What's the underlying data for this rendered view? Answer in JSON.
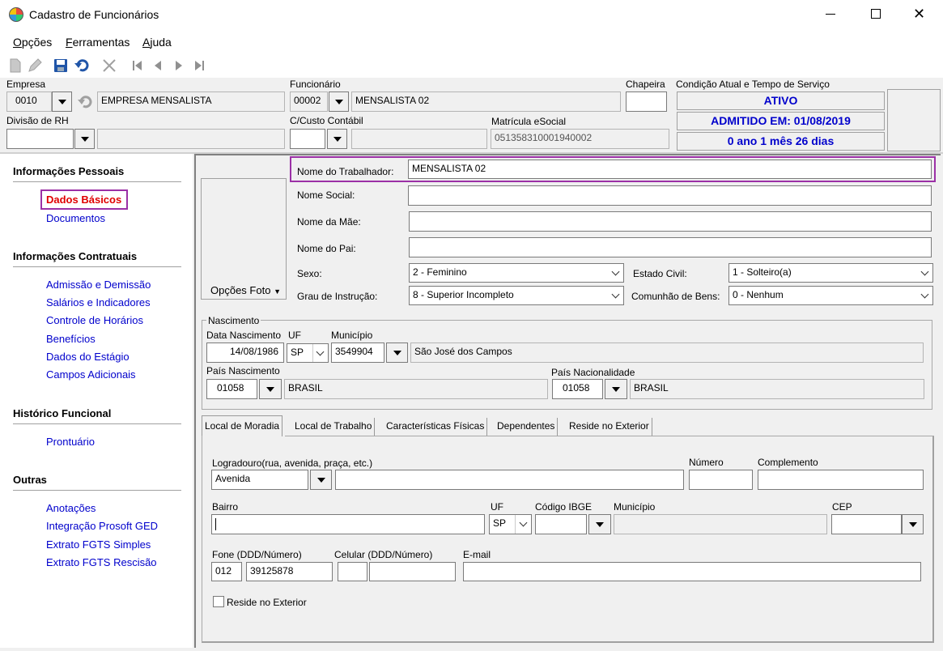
{
  "window": {
    "title": "Cadastro de Funcionários"
  },
  "menu": [
    {
      "pre": "",
      "key": "O",
      "post": "pções"
    },
    {
      "pre": "",
      "key": "F",
      "post": "erramentas"
    },
    {
      "pre": "",
      "key": "A",
      "post": "juda"
    }
  ],
  "header": {
    "empresa_label": "Empresa",
    "empresa_code": "0010",
    "empresa_name": "EMPRESA MENSALISTA",
    "divisao_label": "Divisão de RH",
    "divisao_code": "",
    "divisao_name": "",
    "funcionario_label": "Funcionário",
    "funcionario_code": "00002",
    "funcionario_name": "MENSALISTA 02",
    "ccusto_label": "C/Custo Contábil",
    "ccusto_code": "",
    "ccusto_name": "",
    "chapeira_label": "Chapeira",
    "chapeira_value": "",
    "matricula_label": "Matrícula eSocial",
    "matricula_value": "051358310001940002",
    "condicao_label": "Condição Atual e Tempo de Serviço",
    "status": [
      "ATIVO",
      "ADMITIDO EM: 01/08/2019",
      "0 ano 1 mês 26 dias"
    ]
  },
  "nav": {
    "sections": [
      {
        "title": "Informações Pessoais",
        "items": [
          "Dados Básicos",
          "Documentos"
        ]
      },
      {
        "title": "Informações Contratuais",
        "items": [
          "Admissão e Demissão",
          "Salários e Indicadores",
          "Controle de Horários",
          "Benefícios",
          "Dados do Estágio",
          "Campos Adicionais"
        ]
      },
      {
        "title": "Histórico Funcional",
        "items": [
          "Prontuário"
        ]
      },
      {
        "title": "Outras",
        "items": [
          "Anotações",
          "Integração Prosoft GED",
          "Extrato FGTS Simples",
          "Extrato FGTS Rescisão"
        ]
      }
    ]
  },
  "basic": {
    "photo_button": "Opções Foto",
    "nome_label": "Nome do Trabalhador:",
    "nome_value": "MENSALISTA 02",
    "social_label": "Nome Social:",
    "social_value": "",
    "mae_label": "Nome da Mãe:",
    "mae_value": "",
    "pai_label": "Nome do Pai:",
    "pai_value": "",
    "sexo_label": "Sexo:",
    "sexo_value": "2 - Feminino",
    "civil_label": "Estado Civil:",
    "civil_value": "1 - Solteiro(a)",
    "grau_label": "Grau de Instrução:",
    "grau_value": "8 - Superior Incompleto",
    "comunhao_label": "Comunhão de Bens:",
    "comunhao_value": "0 - Nenhum"
  },
  "nascimento": {
    "group_label": "Nascimento",
    "data_label": "Data Nascimento",
    "data_value": "14/08/1986",
    "uf_label": "UF",
    "uf_value": "SP",
    "mun_label": "Município",
    "mun_code": "3549904",
    "mun_name": "São José dos Campos",
    "pais_label": "País Nascimento",
    "pais_code": "01058",
    "pais_name": "BRASIL",
    "nac_label": "País Nacionalidade",
    "nac_code": "01058",
    "nac_name": "BRASIL"
  },
  "tabs": [
    "Local de Moradia",
    "Local de Trabalho",
    "Características Físicas",
    "Dependentes",
    "Reside no Exterior"
  ],
  "moradia": {
    "logradouro_label": "Logradouro(rua, avenida, praça, etc.)",
    "logradouro_tipo": "Avenida",
    "logradouro_value": "",
    "numero_label": "Número",
    "numero_value": "",
    "complemento_label": "Complemento",
    "complemento_value": "",
    "bairro_label": "Bairro",
    "bairro_value": "",
    "uf_label": "UF",
    "uf_value": "SP",
    "ibge_label": "Código IBGE",
    "ibge_value": "",
    "municipio_label": "Município",
    "municipio_value": "",
    "cep_label": "CEP",
    "cep_value": "",
    "fone_label": "Fone (DDD/Número)",
    "fone_ddd": "012",
    "fone_num": "39125878",
    "celular_label": "Celular (DDD/Número)",
    "celular_ddd": "",
    "celular_num": "",
    "email_label": "E-mail",
    "email_value": "",
    "exterior_label": "Reside no Exterior"
  }
}
